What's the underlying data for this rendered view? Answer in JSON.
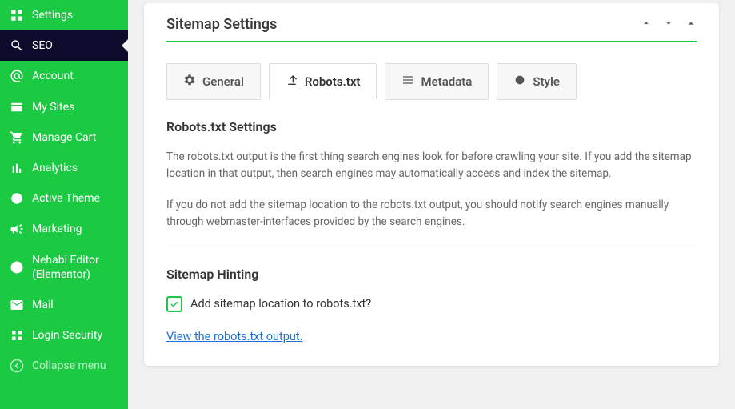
{
  "sidebar": {
    "items": [
      {
        "label": "Settings"
      },
      {
        "label": "SEO"
      },
      {
        "label": "Account"
      },
      {
        "label": "My Sites"
      },
      {
        "label": "Manage Cart"
      },
      {
        "label": "Analytics"
      },
      {
        "label": "Active Theme"
      },
      {
        "label": "Marketing"
      },
      {
        "label": "Nehabi Editor (Elementor)"
      },
      {
        "label": "Mail"
      },
      {
        "label": "Login Security"
      },
      {
        "label": "Collapse menu"
      }
    ]
  },
  "panel": {
    "title": "Sitemap Settings"
  },
  "tabs": [
    {
      "label": "General"
    },
    {
      "label": "Robots.txt"
    },
    {
      "label": "Metadata"
    },
    {
      "label": "Style"
    }
  ],
  "section1": {
    "title": "Robots.txt Settings",
    "p1": "The robots.txt output is the first thing search engines look for before crawling your site. If you add the sitemap location in that output, then search engines may automatically access and index the sitemap.",
    "p2": "If you do not add the sitemap location to the robots.txt output, you should notify search engines manually through webmaster-interfaces provided by the search engines."
  },
  "section2": {
    "title": "Sitemap Hinting",
    "checkbox_label": "Add sitemap location to robots.txt?",
    "link": "View the robots.txt output."
  }
}
